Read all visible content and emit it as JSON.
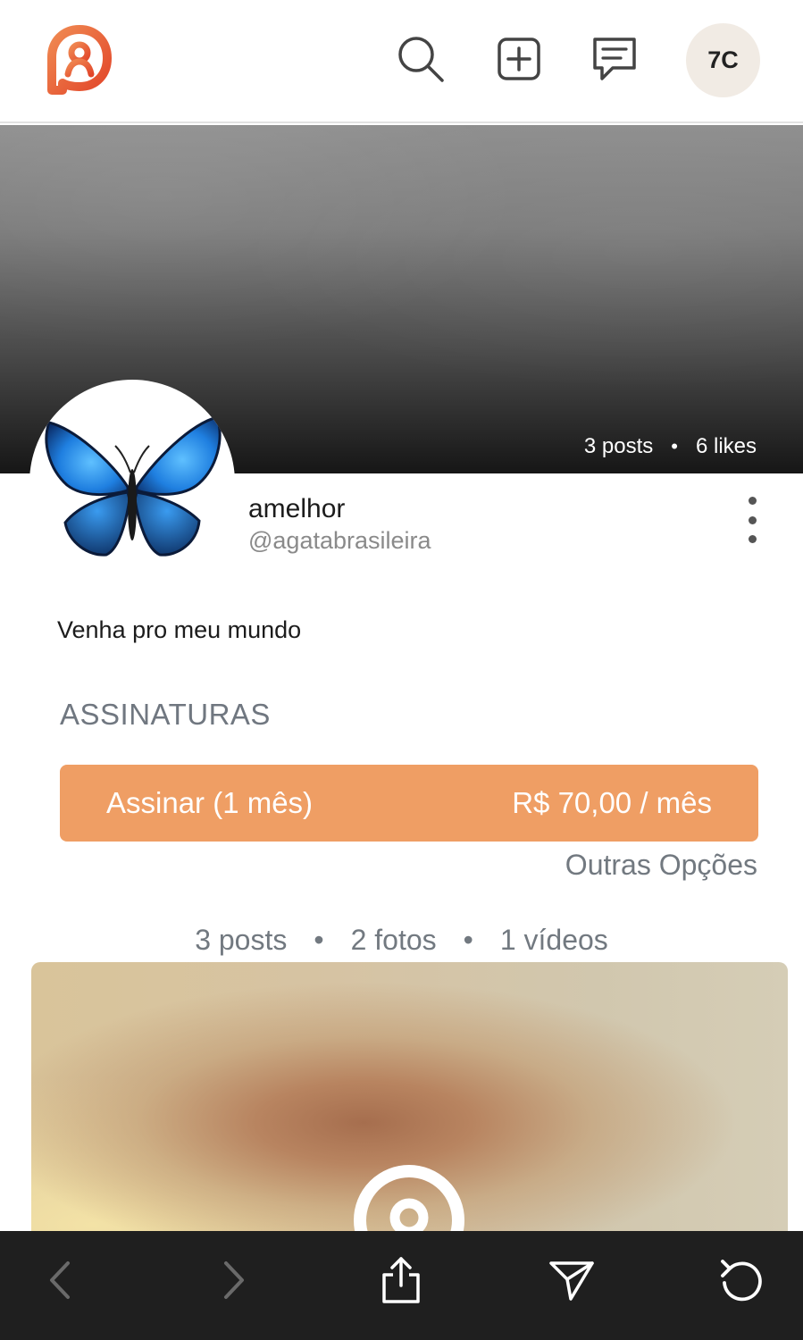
{
  "header": {
    "logo_icon": "privacy-logo-icon",
    "search_icon": "search-icon",
    "create_post_icon": "plus-square-icon",
    "messages_icon": "chat-icon",
    "user_avatar_initials": "7C"
  },
  "profile": {
    "cover_stats": {
      "posts": "3 posts",
      "separator": "•",
      "likes": "6 likes"
    },
    "avatar_icon": "butterfly-avatar",
    "display_name": "amelhor",
    "handle": "@agatabrasileira",
    "bio": "Venha pro meu mundo"
  },
  "subscriptions": {
    "section_title": "ASSINATURAS",
    "subscribe_label": "Assinar (1 mês)",
    "subscribe_price": "R$ 70,00 / mês",
    "other_options": "Outras Opções"
  },
  "content_stats": {
    "posts": "3 posts",
    "photos": "2 fotos",
    "videos": "1 vídeos",
    "separator": "•"
  },
  "browser_bar": {
    "back_icon": "chevron-left-icon",
    "forward_icon": "chevron-right-icon",
    "share_icon": "share-icon",
    "send_icon": "send-icon",
    "reload_icon": "reload-icon"
  },
  "colors": {
    "accent": "#ef9e64",
    "brand": "#e8572f",
    "muted_text": "#727980",
    "bottom_bar": "#1f1f1f"
  }
}
